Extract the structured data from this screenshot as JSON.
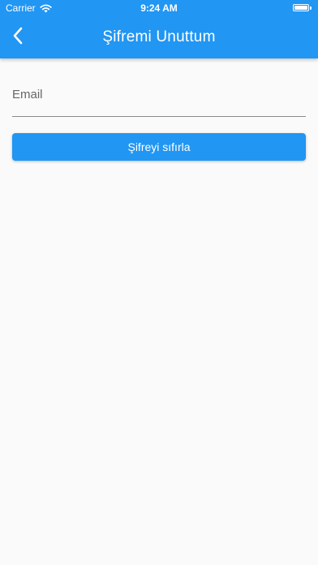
{
  "status_bar": {
    "carrier": "Carrier",
    "time": "9:24 AM",
    "battery_level": 1.0
  },
  "app_bar": {
    "title": "Şifremi Unuttum",
    "color": "#2196f3"
  },
  "form": {
    "email_placeholder": "Email",
    "email_value": "",
    "reset_button_label": "Şifreyi sıfırla"
  }
}
